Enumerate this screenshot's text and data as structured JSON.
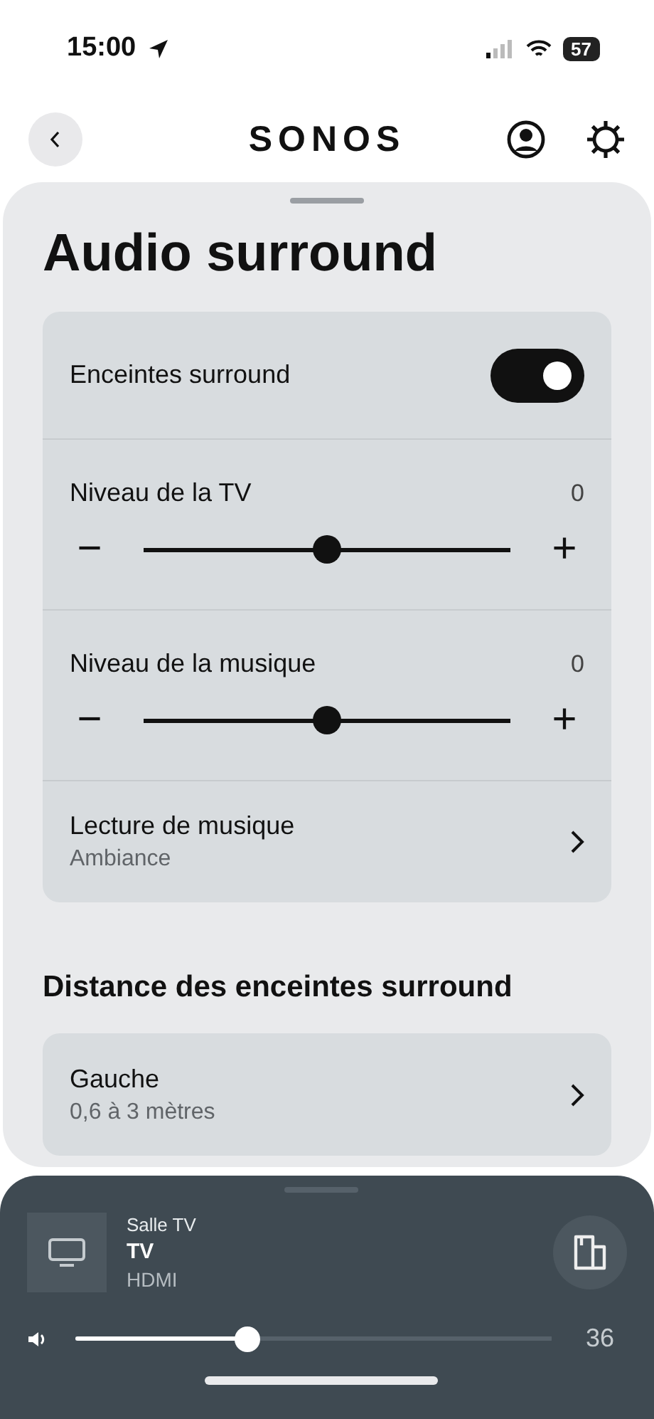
{
  "status_bar": {
    "time": "15:00",
    "battery": "57"
  },
  "header": {
    "logo": "SONOS"
  },
  "title": "Audio surround",
  "settings": [
    {
      "kind": "toggle",
      "label": "Enceintes surround",
      "on": true
    },
    {
      "kind": "slider",
      "label": "Niveau de la TV",
      "reading": "0",
      "level": 0.5,
      "minus": "−",
      "plus": "+"
    },
    {
      "kind": "slider",
      "label": "Niveau de la musique",
      "reading": "0",
      "level": 0.5,
      "minus": "−",
      "plus": "+"
    },
    {
      "kind": "link",
      "label": "Lecture de musique",
      "value": "Ambiance"
    }
  ],
  "distance": {
    "heading": "Distance des enceintes surround",
    "items": [
      {
        "label": "Gauche",
        "value": "0,6 à 3 mètres"
      }
    ]
  },
  "player": {
    "room": "Salle TV",
    "source": "TV",
    "input": "HDMI",
    "volume": {
      "level": 0.36,
      "reading": "36"
    }
  }
}
